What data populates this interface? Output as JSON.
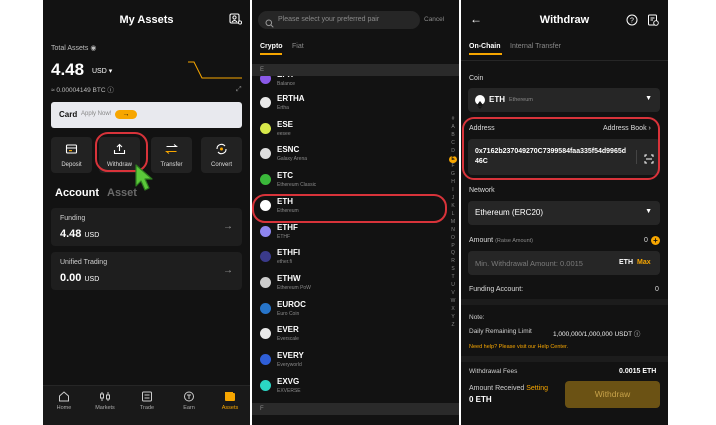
{
  "assets_screen": {
    "title": "My Assets",
    "total_assets_label": "Total Assets",
    "total_value": "4.48",
    "currency": "USD",
    "btc_equiv": "≈ 0.00004149 BTC",
    "promo": {
      "title": "Card",
      "subtitle": "Apply Now!"
    },
    "actions": [
      {
        "label": "Deposit"
      },
      {
        "label": "Withdraw"
      },
      {
        "label": "Transfer"
      },
      {
        "label": "Convert"
      }
    ],
    "tabs": {
      "account": "Account",
      "asset": "Asset"
    },
    "accounts": [
      {
        "name": "Funding",
        "value": "4.48",
        "currency": "USD"
      },
      {
        "name": "Unified Trading",
        "value": "0.00",
        "currency": "USD"
      }
    ],
    "nav": [
      {
        "label": "Home"
      },
      {
        "label": "Markets"
      },
      {
        "label": "Trade"
      },
      {
        "label": "Earn"
      },
      {
        "label": "Assets"
      }
    ]
  },
  "coin_picker": {
    "search_placeholder": "Please select your preferred pair",
    "cancel": "Cancel",
    "tabs": {
      "crypto": "Crypto",
      "fiat": "Fiat"
    },
    "section_top": "E",
    "section_bottom": "F",
    "partial_coin": {
      "symbol": "EPX",
      "name": "Balance"
    },
    "coins": [
      {
        "symbol": "ERTHA",
        "name": "Ertha",
        "color": "#e8e8e8"
      },
      {
        "symbol": "ESE",
        "name": "eesee",
        "color": "#d7e94a"
      },
      {
        "symbol": "ESNC",
        "name": "Galaxy Arena",
        "color": "#dddddd"
      },
      {
        "symbol": "ETC",
        "name": "Ethereum Classic",
        "color": "#3ab83a"
      },
      {
        "symbol": "ETH",
        "name": "Ethereum",
        "color": "#ffffff"
      },
      {
        "symbol": "ETHF",
        "name": "ETHF",
        "color": "#8f86f0"
      },
      {
        "symbol": "ETHFI",
        "name": "ether.fi",
        "color": "#3a3a8a"
      },
      {
        "symbol": "ETHW",
        "name": "Ethereum PoW",
        "color": "#cccccc"
      },
      {
        "symbol": "EUROC",
        "name": "Euro Coin",
        "color": "#2775ca"
      },
      {
        "symbol": "EVER",
        "name": "Everscale",
        "color": "#e8e8e8"
      },
      {
        "symbol": "EVERY",
        "name": "Everyworld",
        "color": "#2f5fd8"
      },
      {
        "symbol": "EXVG",
        "name": "EXVERSE",
        "color": "#2bd6c4"
      }
    ],
    "alphabet": [
      "#",
      "A",
      "B",
      "C",
      "D",
      "E",
      "F",
      "G",
      "H",
      "I",
      "J",
      "K",
      "L",
      "M",
      "N",
      "O",
      "P",
      "Q",
      "R",
      "S",
      "T",
      "U",
      "V",
      "W",
      "X",
      "Y",
      "Z"
    ]
  },
  "withdraw_screen": {
    "title": "Withdraw",
    "tabs": {
      "onchain": "On-Chain",
      "internal": "Internal Transfer"
    },
    "coin_label": "Coin",
    "coin_symbol": "ETH",
    "coin_name": "Ethereum",
    "address_label": "Address",
    "address_book": "Address Book",
    "address_value": "0x7162b237049270C7399584faa335f54d9965d46C",
    "network_label": "Network",
    "network_value": "Ethereum (ERC20)",
    "amount_label": "Amount",
    "amount_hint": "(Raise Amount)",
    "amount_balance": "0",
    "amount_placeholder": "Min. Withdrawal Amount: 0.0015",
    "amount_unit": "ETH",
    "amount_max": "Max",
    "funding_label": "Funding Account:",
    "funding_value": "0",
    "note_label": "Note:",
    "daily_label": "Daily Remaining Limit",
    "daily_value": "1,000,000/1,000,000 USDT",
    "help_text": "Need help? Please visit our Help Center.",
    "fees_label": "Withdrawal Fees",
    "fees_value": "0.0015 ETH",
    "received_label": "Amount Received",
    "received_setting": "Setting",
    "received_value": "0 ETH",
    "withdraw_button": "Withdraw"
  },
  "colors": {
    "accent": "#f7a600",
    "highlight": "#d8333a",
    "background": "#121212"
  }
}
